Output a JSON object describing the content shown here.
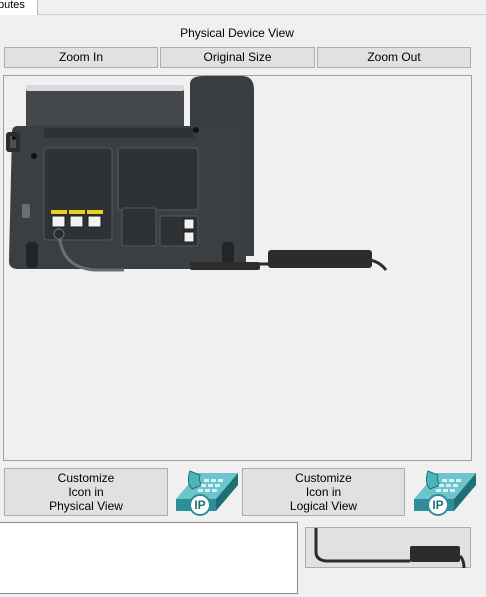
{
  "tab": {
    "label": "butes"
  },
  "panel": {
    "title": "Physical Device View"
  },
  "zoom": {
    "zoom_in": "Zoom In",
    "original_size": "Original Size",
    "zoom_out": "Zoom Out"
  },
  "customize_physical": {
    "line1": "Customize",
    "line2": "Icon in",
    "line3": "Physical View"
  },
  "customize_logical": {
    "line1": "Customize",
    "line2": "Icon in",
    "line3": "Logical View"
  },
  "device_icon": {
    "badge": "IP",
    "icon": "ip-phone-icon"
  },
  "colors": {
    "phone_body": "#3c3f42",
    "phone_dark": "#2a2c2e",
    "port_label": "#e8d21a",
    "icon_teal": "#3aa7b0",
    "background": "#f0f0f0"
  }
}
